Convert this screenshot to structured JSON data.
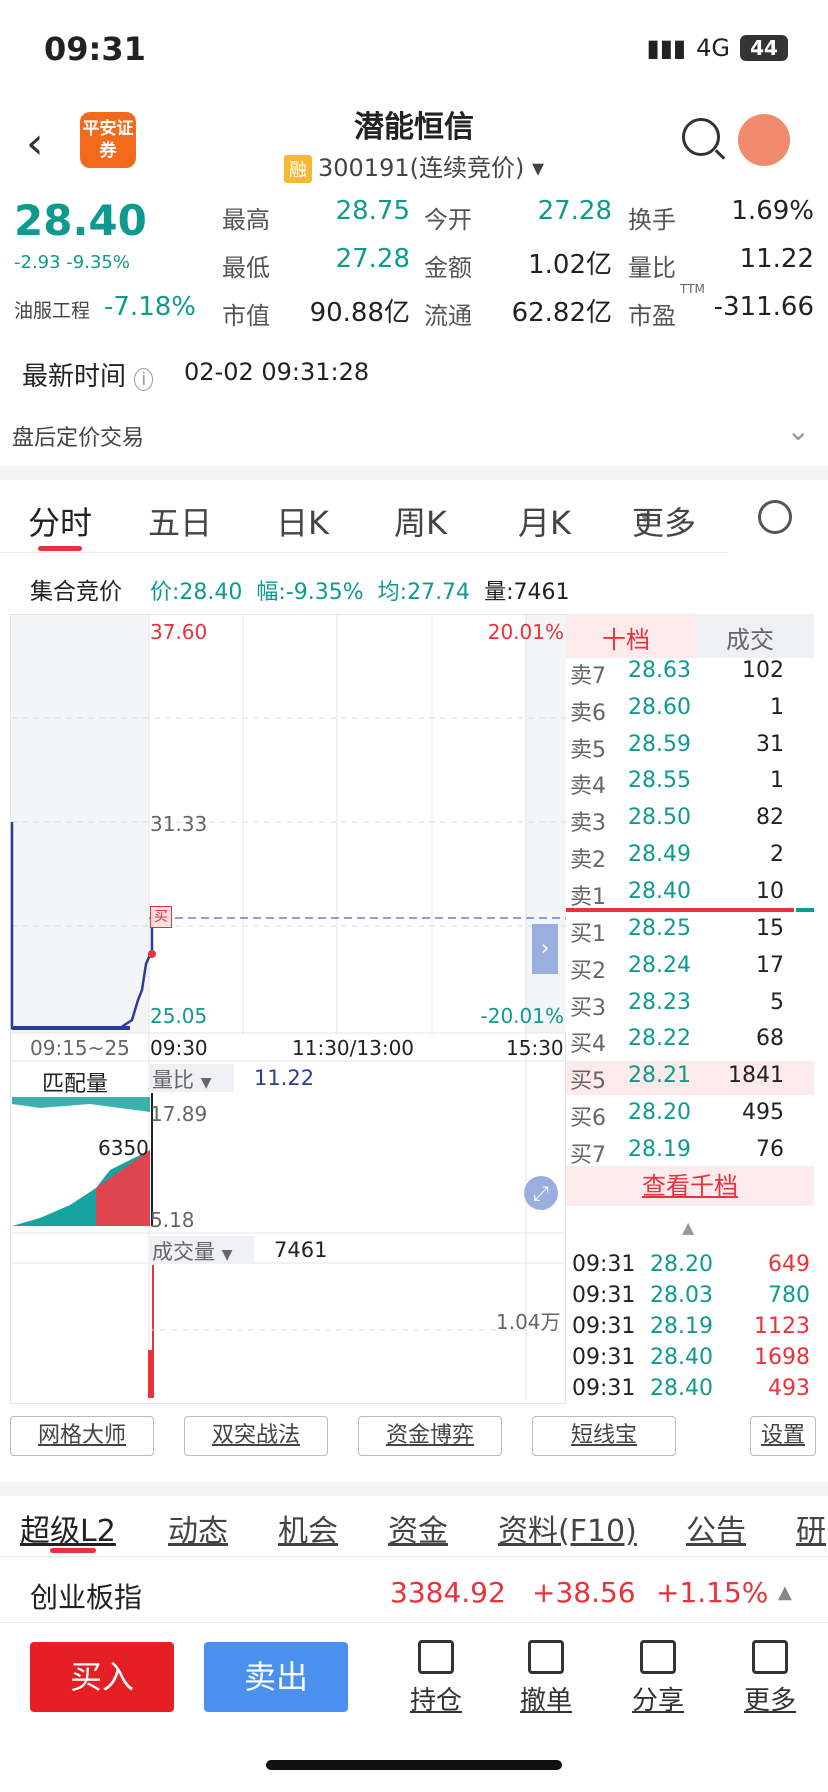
{
  "status": {
    "time": "09:31",
    "network": "4G",
    "battery": "44"
  },
  "header": {
    "logo": "平安证券",
    "title": "潜能恒信",
    "tag": "融",
    "subtitle": "300191(连续竞价)"
  },
  "quote": {
    "price": "28.40",
    "change": "-2.93 -9.35%",
    "sector_name": "油服工程",
    "sector_change": "-7.18%",
    "fields": [
      {
        "label": "最高",
        "value": "28.75",
        "color": "green"
      },
      {
        "label": "今开",
        "value": "27.28",
        "color": "green"
      },
      {
        "label": "换手",
        "value": "1.69%",
        "color": "dark"
      },
      {
        "label": "最低",
        "value": "27.28",
        "color": "green"
      },
      {
        "label": "金额",
        "value": "1.02亿",
        "color": "dark"
      },
      {
        "label": "量比",
        "value": "11.22",
        "color": "dark"
      },
      {
        "label": "市值",
        "value": "90.88亿",
        "color": "dark"
      },
      {
        "label": "流通",
        "value": "62.82亿",
        "color": "dark"
      },
      {
        "label": "市盈",
        "value": "-311.66",
        "color": "dark"
      }
    ],
    "pe_sup": "TTM",
    "latest_label": "最新时间",
    "latest_time": "02-02 09:31:28",
    "post_trade": "盘后定价交易"
  },
  "tabs": [
    "分时",
    "五日",
    "日K",
    "周K",
    "月K",
    "更多"
  ],
  "auction": {
    "label": "集合竞价",
    "price": "价:28.40",
    "amp": "幅:-9.35%",
    "avg": "均:27.74",
    "vol": "量:7461"
  },
  "chart": {
    "top_price": "37.60",
    "mid_price": "31.33",
    "bottom_price": "25.05",
    "top_pct": "20.01%",
    "bottom_pct": "-20.01%",
    "x_labels": [
      "09:15~25",
      "09:30",
      "11:30/13:00",
      "15:30"
    ],
    "match_label": "匹配量",
    "ratio_label": "量比",
    "ratio_value": "11.22",
    "ratio_top": "17.89",
    "ratio_bottom": "5.18",
    "match_value": "6350",
    "vol_label": "成交量",
    "vol_value": "7461",
    "vol_max": "1.04万",
    "buy_marker": "买"
  },
  "orderbook": {
    "tabs": [
      "十档",
      "成交"
    ],
    "asks": [
      {
        "label": "卖7",
        "price": "28.63",
        "vol": "102"
      },
      {
        "label": "卖6",
        "price": "28.60",
        "vol": "1"
      },
      {
        "label": "卖5",
        "price": "28.59",
        "vol": "31"
      },
      {
        "label": "卖4",
        "price": "28.55",
        "vol": "1"
      },
      {
        "label": "卖3",
        "price": "28.50",
        "vol": "82"
      },
      {
        "label": "卖2",
        "price": "28.49",
        "vol": "2"
      },
      {
        "label": "卖1",
        "price": "28.40",
        "vol": "10"
      }
    ],
    "bids": [
      {
        "label": "买1",
        "price": "28.25",
        "vol": "15"
      },
      {
        "label": "买2",
        "price": "28.24",
        "vol": "17"
      },
      {
        "label": "买3",
        "price": "28.23",
        "vol": "5"
      },
      {
        "label": "买4",
        "price": "28.22",
        "vol": "68"
      },
      {
        "label": "买5",
        "price": "28.21",
        "vol": "1841"
      },
      {
        "label": "买6",
        "price": "28.20",
        "vol": "495"
      },
      {
        "label": "买7",
        "price": "28.19",
        "vol": "76"
      }
    ],
    "view_more": "查看千档",
    "trades": [
      {
        "time": "09:31",
        "price": "28.20",
        "vol": "649",
        "color": "red"
      },
      {
        "time": "09:31",
        "price": "28.03",
        "vol": "780",
        "color": "green"
      },
      {
        "time": "09:31",
        "price": "28.19",
        "vol": "1123",
        "color": "red"
      },
      {
        "time": "09:31",
        "price": "28.40",
        "vol": "1698",
        "color": "red"
      },
      {
        "time": "09:31",
        "price": "28.40",
        "vol": "493",
        "color": "red"
      }
    ]
  },
  "tools": [
    "网格大师",
    "双突战法",
    "资金博弈",
    "短线宝",
    "设置"
  ],
  "bottom_tabs": [
    "超级L2",
    "动态",
    "机会",
    "资金",
    "资料(F10)",
    "公告",
    "研"
  ],
  "index": {
    "name": "创业板指",
    "value": "3384.92",
    "change": "+38.56",
    "pct": "+1.15%"
  },
  "actions": {
    "buy": "买入",
    "sell": "卖出",
    "items": [
      "持仓",
      "撤单",
      "分享",
      "更多"
    ]
  }
}
